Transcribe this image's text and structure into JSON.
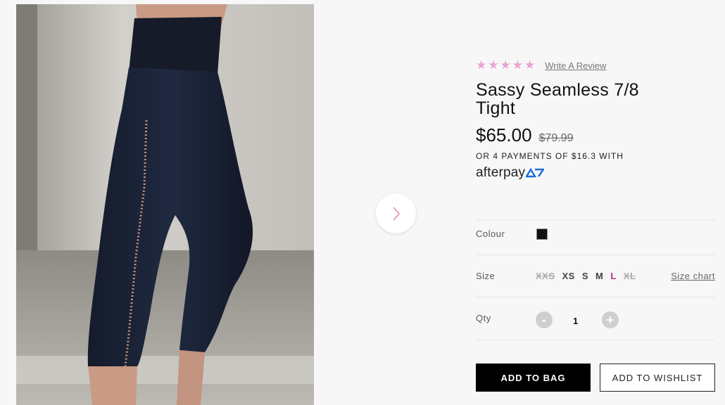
{
  "product": {
    "rating_stars": "★★★★★",
    "review_link": "Write A Review",
    "title": "Sassy Seamless 7/8 Tight",
    "price": "$65.00",
    "old_price": "$79.99",
    "payments_text": "OR 4 PAYMENTS OF $16.3 WITH",
    "afterpay_brand": "afterpay"
  },
  "options": {
    "colour_label": "Colour",
    "colour_hex": "#111111",
    "size_label": "Size",
    "sizes": [
      {
        "label": "XXS",
        "state": "unavailable"
      },
      {
        "label": "XS",
        "state": "available"
      },
      {
        "label": "S",
        "state": "available"
      },
      {
        "label": "M",
        "state": "available"
      },
      {
        "label": "L",
        "state": "selected"
      },
      {
        "label": "XL",
        "state": "unavailable"
      }
    ],
    "size_chart": "Size chart",
    "qty_label": "Qty",
    "qty_minus": "-",
    "qty_value": "1",
    "qty_plus": "+"
  },
  "actions": {
    "add_to_bag": "ADD TO BAG",
    "add_to_wishlist": "ADD TO WISHLIST"
  },
  "icons": {
    "carousel_next": "chevron-right-icon",
    "afterpay_logo": "afterpay-arrows-icon"
  },
  "colors": {
    "star": "#e7a3d3",
    "selected_size": "#b52b8e",
    "carousel_chevron": "#e48ab5"
  }
}
